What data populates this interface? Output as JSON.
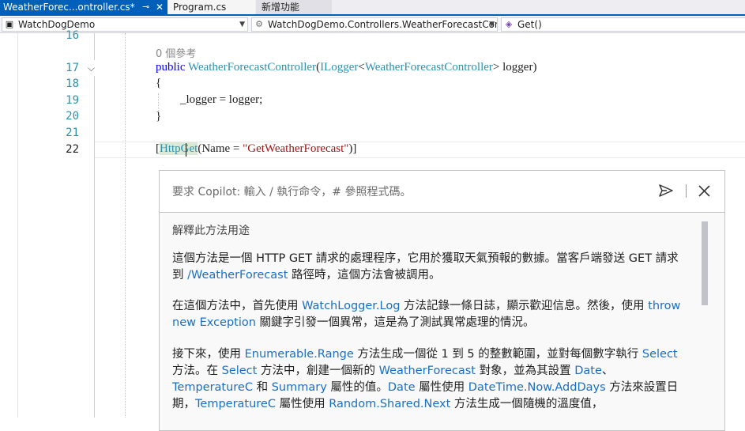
{
  "tabs": {
    "active_label": "WeatherForec...ontroller.cs*",
    "pin_glyph": "⊸",
    "close_glyph": "✕",
    "tab2_label": "Program.cs",
    "tab3_label": "新增功能"
  },
  "navbar": {
    "project": "WatchDogDemo",
    "namespace": "WatchDogDemo.Controllers.WeatherForecastCor",
    "member": "Get()"
  },
  "editor": {
    "line_numbers": [
      "16",
      "17",
      "18",
      "19",
      "20",
      "21",
      "22"
    ],
    "current_line": "22",
    "ref_hint": "0 個參考",
    "line17": {
      "kw": "public",
      "ctor": "WeatherForecastController",
      "paren": "(",
      "type": "ILogger",
      "lt": "<",
      "generic": "WeatherForecastController",
      "rest": "> logger)"
    },
    "line18": "{",
    "line19": "_logger = logger;",
    "line20": "}",
    "line22": {
      "open": "[",
      "attr": "HttpGet",
      "args_open": "(Name = ",
      "string": "\"GetWeatherForecast\"",
      "close": ")]"
    }
  },
  "copilot": {
    "placeholder": "要求 Copilot: 輸入 / 執行命令，# 參照程式碼。",
    "heading": "解釋此方法用途",
    "p1": {
      "t1": "這個方法是一個 HTTP GET 請求的處理程序，它用於獲取天氣預報的數據。當客戶端發送 GET 請求到 ",
      "l1": "/WeatherForecast",
      "t2": " 路徑時，這個方法會被調用。"
    },
    "p2": {
      "t1": "在這個方法中，首先使用 ",
      "l1": "WatchLogger.Log",
      "t2": " 方法記錄一條日誌，顯示歡迎信息。然後，使用 ",
      "l2": "throw new Exception",
      "t3": " 關鍵字引發一個異常，這是為了測試異常處理的情況。"
    },
    "p3": {
      "t1": "接下來，使用 ",
      "l1": "Enumerable.Range",
      "t2": " 方法生成一個從 1 到 5 的整數範圍，並對每個數字執行 ",
      "l2": "Select",
      "t3": " 方法。在 ",
      "l3": "Select",
      "t4": " 方法中，創建一個新的 ",
      "l4": "WeatherForecast",
      "t5": " 對象，並為其設置 ",
      "l5": "Date",
      "t6": "、",
      "l6": "TemperatureC",
      "t7": " 和 ",
      "l7": "Summary",
      "t8": " 屬性的值。",
      "l8": "Date",
      "t9": " 屬性使用 ",
      "l9": "DateTime.Now.AddDays",
      "t10": " 方法來設置日期，",
      "l10": "TemperatureC",
      "t11": " 屬性使用 ",
      "l11": "Random.Shared.Next",
      "t12": " 方法生成一個隨機的溫度值，"
    }
  }
}
